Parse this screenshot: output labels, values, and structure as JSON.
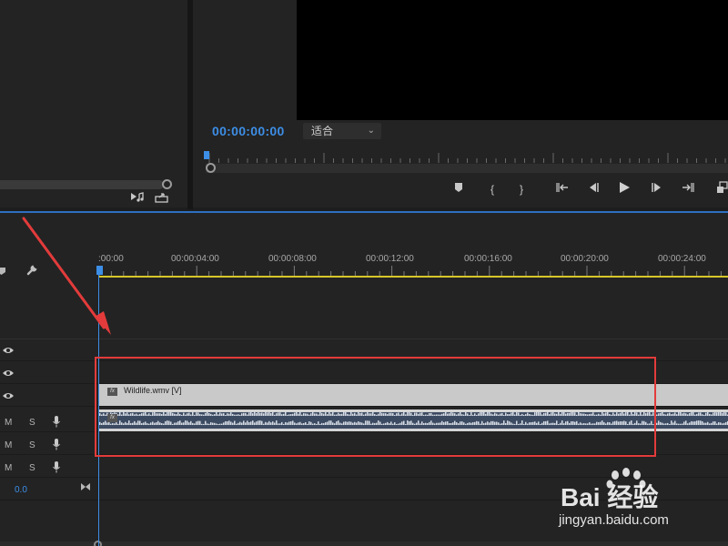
{
  "program_monitor": {
    "timecode": "00:00:00:00",
    "fit_select": {
      "value": "适合"
    }
  },
  "timeline": {
    "ruler_labels": [
      ":00:00",
      "00:00:04:00",
      "00:00:08:00",
      "00:00:12:00",
      "00:00:16:00",
      "00:00:20:00",
      "00:00:24:00"
    ],
    "audio_tracks": [
      {
        "mute": "M",
        "solo": "S"
      },
      {
        "mute": "M",
        "solo": "S"
      },
      {
        "mute": "M",
        "solo": "S"
      }
    ],
    "video_clip": {
      "label": "Wildlife.wmv [V]",
      "fx": "fx"
    },
    "audio_clip": {
      "fx": "fx"
    },
    "master_volume": "0.0"
  },
  "watermark": {
    "brand": "Bai 经验",
    "url": "jingyan.baidu.com"
  },
  "colors": {
    "accent_blue": "#3d8ee6",
    "ruler_yellow": "#d8c628",
    "annotation_red": "#e33b3b",
    "audio_clip": "#3c4b62",
    "video_clip": "#c9c9c9"
  }
}
